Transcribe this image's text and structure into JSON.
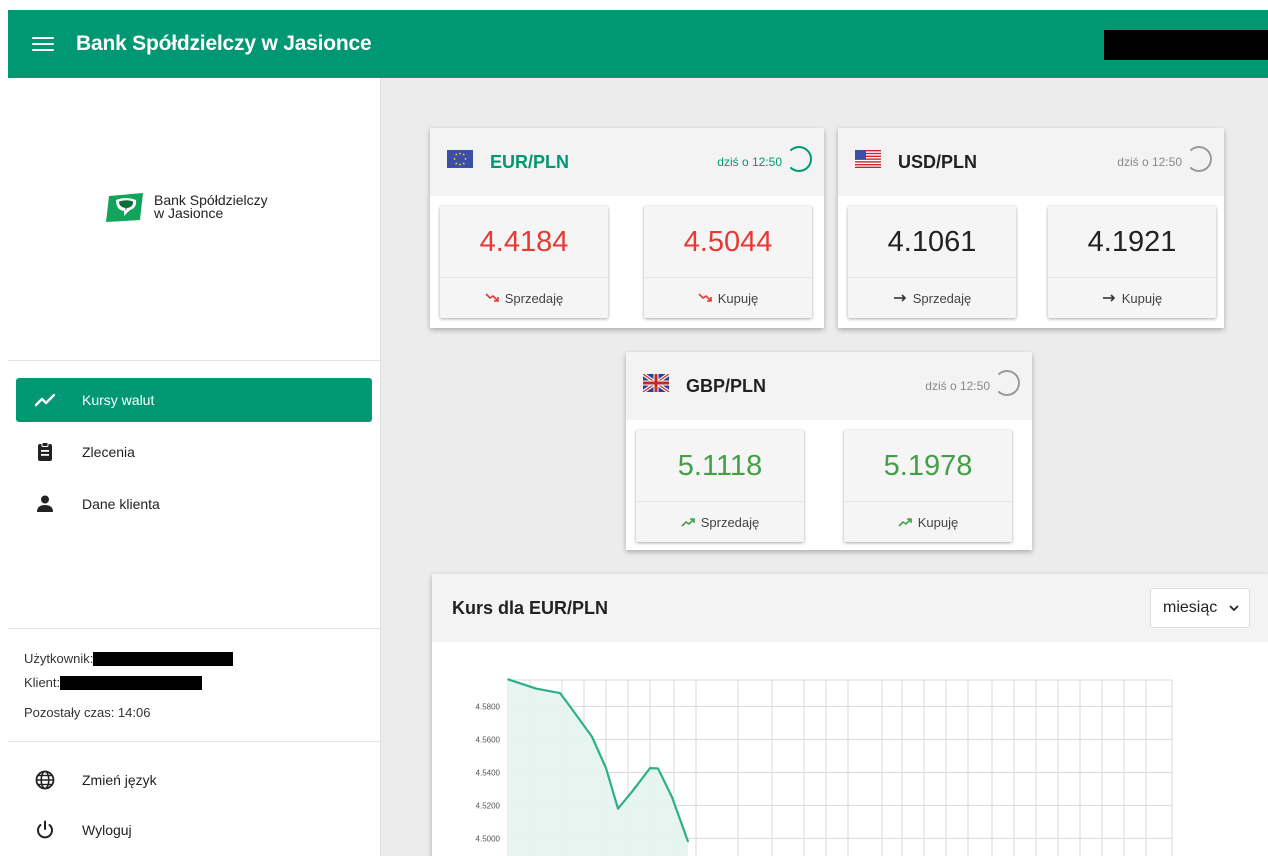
{
  "app": {
    "title": "Bank Spółdzielczy w Jasionce"
  },
  "sidebar": {
    "logo": {
      "line1": "Bank Spółdzielczy",
      "line2": "w Jasionce"
    },
    "nav": [
      {
        "label": "Kursy walut",
        "icon": "trending-up-icon",
        "active": true
      },
      {
        "label": "Zlecenia",
        "icon": "clipboard-icon",
        "active": false
      },
      {
        "label": "Dane klienta",
        "icon": "person-icon",
        "active": false
      }
    ],
    "user": {
      "user_label": "Użytkownik:",
      "client_label": "Klient:",
      "time_label": "Pozostały czas: 14:06"
    },
    "bottom": [
      {
        "label": "Zmień język",
        "icon": "globe-icon"
      },
      {
        "label": "Wyloguj",
        "icon": "power-icon"
      }
    ]
  },
  "rates": [
    {
      "pair": "EUR/PLN",
      "updated": "dziś o 12:50",
      "flag": "eu-flag-icon",
      "sell": "4.4184",
      "buy": "4.5044",
      "sell_label": "Sprzedaję",
      "buy_label": "Kupuję",
      "trend": "down",
      "color": "#e53935"
    },
    {
      "pair": "USD/PLN",
      "updated": "dziś o 12:50",
      "flag": "us-flag-icon",
      "sell": "4.1061",
      "buy": "4.1921",
      "sell_label": "Sprzedaję",
      "buy_label": "Kupuję",
      "trend": "flat",
      "color": "#222222"
    },
    {
      "pair": "GBP/PLN",
      "updated": "dziś o 12:50",
      "flag": "uk-flag-icon",
      "sell": "5.1118",
      "buy": "5.1978",
      "sell_label": "Sprzedaję",
      "buy_label": "Kupuję",
      "trend": "up",
      "color": "#43a047"
    }
  ],
  "chart": {
    "title": "Kurs dla EUR/PLN",
    "period": "miesiąc"
  },
  "chart_data": {
    "type": "area",
    "title": "",
    "xlabel": "",
    "ylabel": "",
    "x": [
      1,
      2,
      3,
      4,
      5,
      6,
      7,
      8,
      9,
      10,
      11,
      12
    ],
    "values": [
      4.5964,
      4.5908,
      4.5881,
      4.58,
      4.5616,
      4.5426,
      4.518,
      4.5283,
      4.5426,
      4.5424,
      4.525,
      4.4981
    ],
    "yticks": [
      "4.5800",
      "4.5600",
      "4.5400",
      "4.5200",
      "4.5000"
    ],
    "ylim": [
      4.4981,
      4.5964
    ],
    "grid": true,
    "accent": "#2eae8a"
  }
}
